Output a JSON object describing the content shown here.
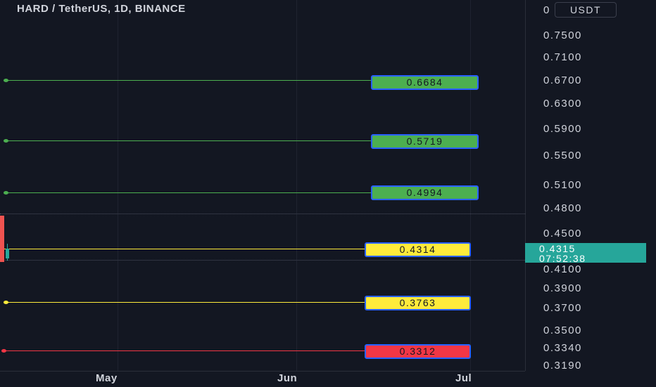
{
  "header": {
    "title": "HARD / TetherUS, 1D, BINANCE"
  },
  "price_scale": {
    "currency": "USDT",
    "top_tick": "0",
    "ticks": [
      "0.7500",
      "0.7100",
      "0.6700",
      "0.6300",
      "0.5900",
      "0.5500",
      "0.5100",
      "0.4800",
      "0.4500",
      "0.4100",
      "0.3900",
      "0.3700",
      "0.3500",
      "0.3340",
      "0.3190"
    ],
    "last_price": "0.4315",
    "countdown": "07:52:38"
  },
  "time_scale": {
    "ticks": [
      "May",
      "Jun",
      "Jul"
    ]
  },
  "levels": [
    {
      "label": "0.6684",
      "color": "#4caf50",
      "kind": "resistance"
    },
    {
      "label": "0.5719",
      "color": "#4caf50",
      "kind": "resistance"
    },
    {
      "label": "0.4994",
      "color": "#4caf50",
      "kind": "resistance"
    },
    {
      "label": "0.4314",
      "color": "#ffeb3b",
      "kind": "pivot"
    },
    {
      "label": "0.3763",
      "color": "#ffeb3b",
      "kind": "support"
    },
    {
      "label": "0.3312",
      "color": "#f23645",
      "kind": "support"
    }
  ],
  "colors": {
    "background": "#131722",
    "last_price_bg": "#26a69a",
    "tag_border": "#2962ff"
  }
}
